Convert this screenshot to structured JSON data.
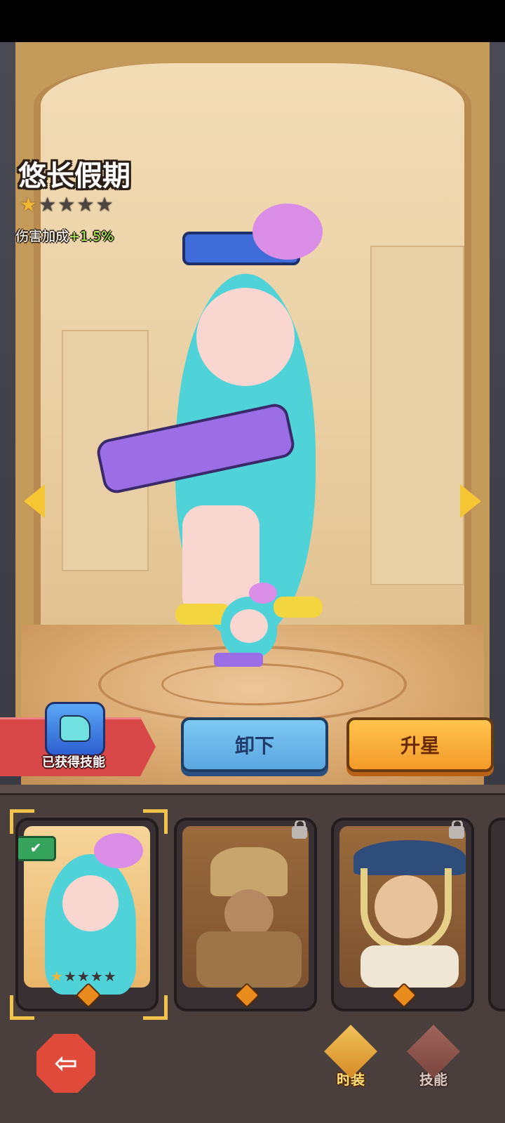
{
  "hero": {
    "title": "悠长假期",
    "stars_total": 5,
    "stars_filled": 1,
    "bonus_label": "伤害加成",
    "bonus_value": "+1.5%"
  },
  "skill_badge": {
    "label": "已获得技能",
    "icon": "water-gun-skill-icon"
  },
  "buttons": {
    "unequip": "卸下",
    "upgrade": "升星"
  },
  "cards": [
    {
      "name": "swimsuit-octopus-girl",
      "selected": true,
      "equipped": true,
      "locked": false,
      "stars_filled": 1,
      "stars_total": 5
    },
    {
      "name": "horned-knight",
      "selected": false,
      "equipped": false,
      "locked": true
    },
    {
      "name": "pirate-captain",
      "selected": false,
      "equipped": false,
      "locked": true
    }
  ],
  "bottom_nav": {
    "costume": "时装",
    "skill": "技能"
  },
  "colors": {
    "star_on": "#f0b635",
    "bonus": "#9ef24c",
    "unequip": "#6bb6ea",
    "upgrade": "#f5a734"
  }
}
